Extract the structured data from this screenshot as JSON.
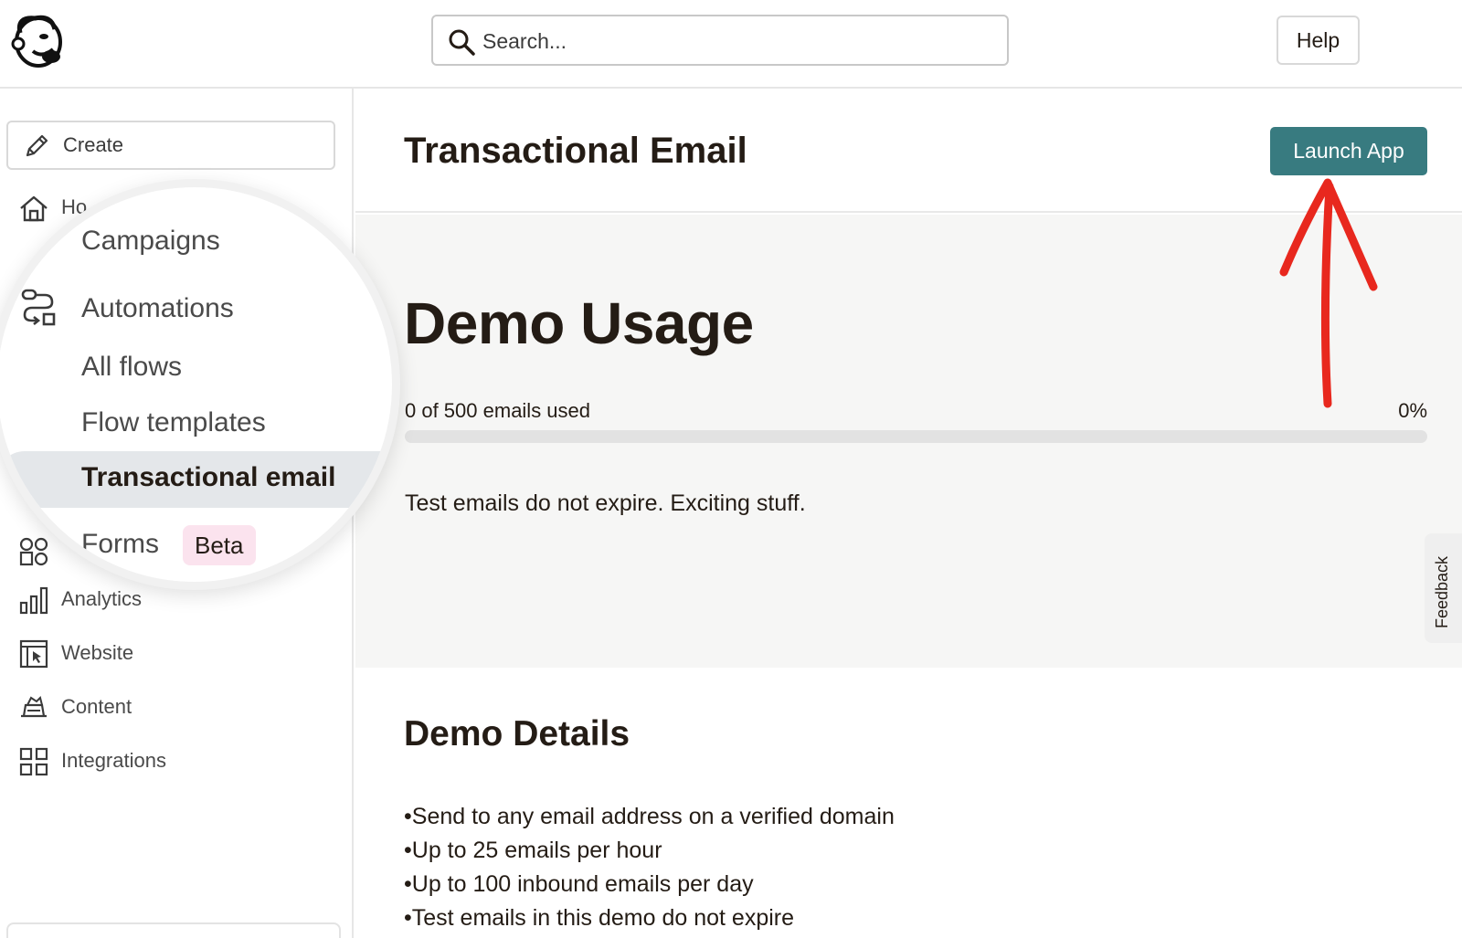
{
  "topbar": {
    "logo_icon": "mailchimp-freddie-logo",
    "search_placeholder": "Search...",
    "help_label": "Help"
  },
  "sidebar": {
    "create_label": "Create",
    "items": [
      {
        "label": "Ho",
        "icon": "home-icon"
      },
      {
        "label": "Analytics",
        "icon": "bar-chart-icon"
      },
      {
        "label": "Website",
        "icon": "website-icon"
      },
      {
        "label": "Content",
        "icon": "content-icon"
      },
      {
        "label": "Integrations",
        "icon": "grid-icon"
      }
    ]
  },
  "magnifier": {
    "campaigns": "Campaigns",
    "automations": "Automations",
    "all_flows": "All flows",
    "flow_templates": "Flow templates",
    "transactional_email": "Transactional email",
    "forms": "Forms",
    "beta": "Beta"
  },
  "main": {
    "title": "Transactional Email",
    "launch_label": "Launch App",
    "usage": {
      "title": "Demo Usage",
      "text": "0 of 500 emails used",
      "percent_label": "0%",
      "progress_fraction": 0,
      "note": "Test emails do not expire. Exciting stuff."
    },
    "details": {
      "title": "Demo Details",
      "items": [
        "Send to any email address on a verified domain",
        "Up to 25 emails per hour",
        "Up to 100 inbound emails per day",
        "Test emails in this demo do not expire"
      ]
    },
    "feedback_label": "Feedback"
  },
  "colors": {
    "accent": "#387b80",
    "annotation_arrow": "#e8281e",
    "beta_bg": "#fbe3ee"
  }
}
